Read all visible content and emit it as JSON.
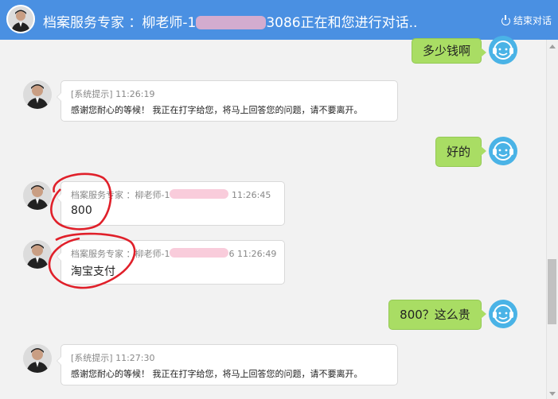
{
  "header": {
    "title_prefix": "档案服务专家 ：柳老师-1",
    "title_suffix": "3086正在和您进行对话..",
    "end_label": "结束对话"
  },
  "messages": [
    {
      "side": "out",
      "text": "多少钱啊"
    },
    {
      "side": "in",
      "meta": "[系统提示] 11:26:19",
      "text": "感谢您耐心的等候！ 我正在打字给您，将马上回答您的问题，请不要离开。"
    },
    {
      "side": "out",
      "text": "好的"
    },
    {
      "side": "in",
      "meta_prefix": "档案服务专家 ：柳老师-1",
      "time": "11:26:45",
      "text": "800"
    },
    {
      "side": "in",
      "meta_prefix": "档案服务专家 ：柳老师-1",
      "meta_mid": "6",
      "time": "11:26:49",
      "text": "淘宝支付"
    },
    {
      "side": "out",
      "text": "800？这么贵"
    },
    {
      "side": "in",
      "meta": "[系统提示] 11:27:30",
      "text": "感谢您耐心的等候！ 我正在打字给您，将马上回答您的问题，请不要离开。"
    }
  ],
  "icons": {
    "avatar": "agent-avatar",
    "customer": "customer-service-icon",
    "power": "power-icon"
  },
  "colors": {
    "header": "#4a90e2",
    "outgoing_bubble": "#a9dd64",
    "customer_icon": "#4ab3e6",
    "annotation": "#e0202a"
  }
}
